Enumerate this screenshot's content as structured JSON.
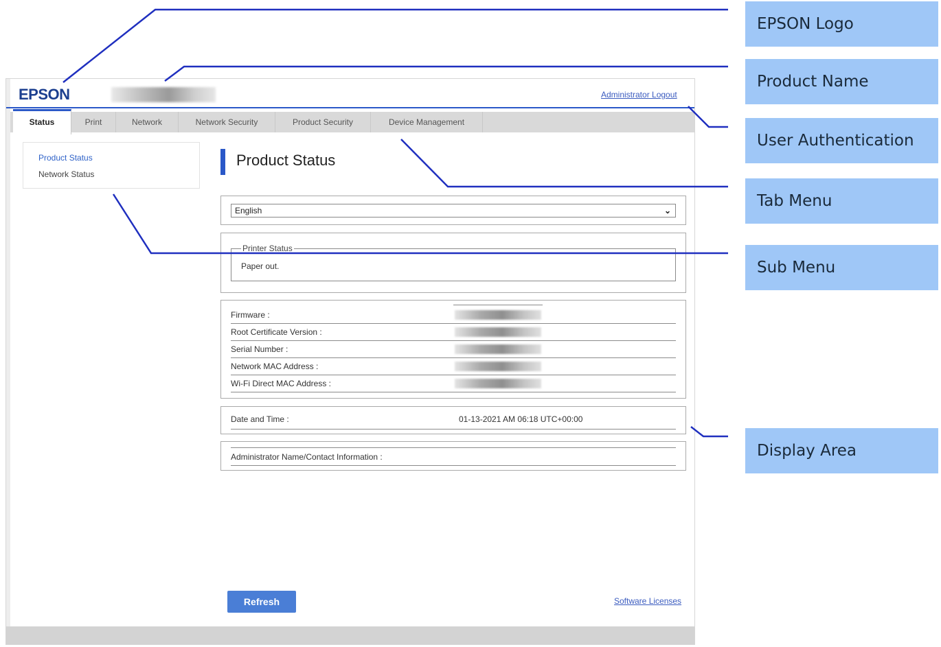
{
  "header": {
    "logo": "EPSON",
    "admin_link": "Administrator Logout"
  },
  "tabs": [
    {
      "label": "Status",
      "active": true
    },
    {
      "label": "Print",
      "active": false
    },
    {
      "label": "Network",
      "active": false
    },
    {
      "label": "Network Security",
      "active": false
    },
    {
      "label": "Product Security",
      "active": false
    },
    {
      "label": "Device Management",
      "active": false
    }
  ],
  "submenu": {
    "items": [
      {
        "label": "Product Status",
        "selected": true
      },
      {
        "label": "Network Status",
        "selected": false
      }
    ]
  },
  "main": {
    "title": "Product Status",
    "language_select": {
      "value": "English"
    },
    "printer_status": {
      "legend": "Printer Status",
      "text": "Paper out."
    },
    "info_rows": [
      {
        "label": "Firmware :"
      },
      {
        "label": "Root Certificate Version :"
      },
      {
        "label": "Serial Number :"
      },
      {
        "label": "Network MAC Address :"
      },
      {
        "label": "Wi-Fi Direct MAC Address :"
      }
    ],
    "date_time": {
      "label": "Date and Time :",
      "value": "01-13-2021 AM 06:18 UTC+00:00"
    },
    "admin_info": {
      "label": "Administrator Name/Contact Information :"
    },
    "refresh_button": "Refresh",
    "software_licenses_link": "Software Licenses"
  },
  "callouts": [
    "EPSON Logo",
    "Product Name",
    "User Authentication",
    "Tab Menu",
    "Sub Menu",
    "Display Area"
  ],
  "colors": {
    "accent": "#2a58c8",
    "link": "#3a5bbf",
    "button": "#4a7ed6",
    "callout_bg": "#9fc7f7",
    "leader_line": "#1f2fbf"
  },
  "icons": {
    "select_arrow": "chevron-down-icon"
  }
}
